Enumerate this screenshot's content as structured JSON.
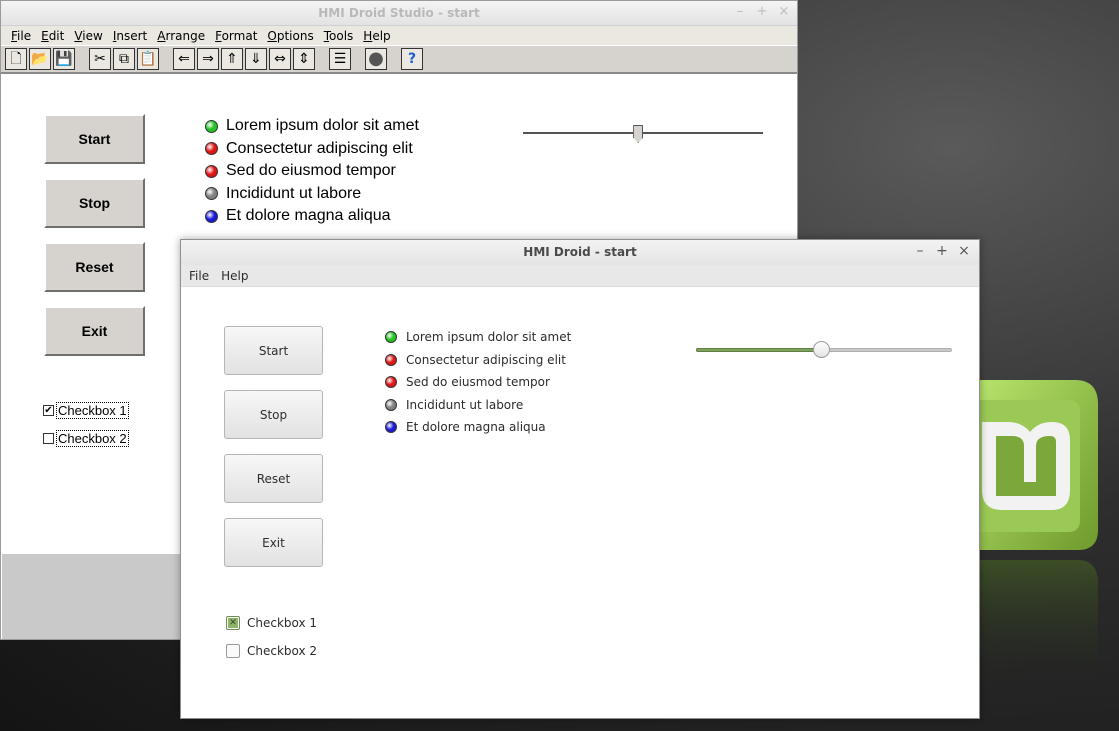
{
  "studio": {
    "title": "HMI Droid Studio - start",
    "window_controls": [
      "–",
      "+",
      "×"
    ],
    "menu": [
      "File",
      "Edit",
      "View",
      "Insert",
      "Arrange",
      "Format",
      "Options",
      "Tools",
      "Help"
    ],
    "toolbar": [
      {
        "icon": "new-file-icon",
        "glyph": "🗋"
      },
      {
        "icon": "open-folder-icon",
        "glyph": "📂"
      },
      {
        "icon": "save-icon",
        "glyph": "💾"
      },
      {
        "icon": "cut-icon",
        "glyph": "✂"
      },
      {
        "icon": "copy-icon",
        "glyph": "⧉"
      },
      {
        "icon": "paste-icon",
        "glyph": "📋"
      },
      {
        "icon": "arrow-left-icon",
        "glyph": "⇐"
      },
      {
        "icon": "arrow-right-icon",
        "glyph": "⇒"
      },
      {
        "icon": "arrow-up-icon",
        "glyph": "⇑"
      },
      {
        "icon": "arrow-down-icon",
        "glyph": "⇓"
      },
      {
        "icon": "arrow-horizontal-icon",
        "glyph": "⇔"
      },
      {
        "icon": "arrow-vertical-icon",
        "glyph": "⇕"
      },
      {
        "icon": "properties-icon",
        "glyph": "☰"
      },
      {
        "icon": "record-icon",
        "glyph": "●"
      },
      {
        "icon": "help-icon",
        "glyph": "?"
      }
    ],
    "buttons": [
      "Start",
      "Stop",
      "Reset",
      "Exit"
    ],
    "leds": [
      {
        "label": "Lorem ipsum dolor sit amet",
        "color": "#22c322"
      },
      {
        "label": "Consectetur adipiscing elit",
        "color": "#e01515"
      },
      {
        "label": "Sed do eiusmod tempor",
        "color": "#e01515"
      },
      {
        "label": "Incididunt ut labore",
        "color": "#808080"
      },
      {
        "label": "Et dolore magna aliqua",
        "color": "#1a1ad6"
      }
    ],
    "slider_value": 0.48,
    "checkboxes": [
      {
        "label": "Checkbox 1",
        "checked": true
      },
      {
        "label": "Checkbox 2",
        "checked": false
      }
    ]
  },
  "droid": {
    "title": "HMI Droid - start",
    "window_controls": [
      "–",
      "+",
      "×"
    ],
    "menu": [
      "File",
      "Help"
    ],
    "buttons": [
      "Start",
      "Stop",
      "Reset",
      "Exit"
    ],
    "leds": [
      {
        "label": "Lorem ipsum dolor sit amet",
        "color": "#22c322"
      },
      {
        "label": "Consectetur adipiscing elit",
        "color": "#e01515"
      },
      {
        "label": "Sed do eiusmod tempor",
        "color": "#e01515"
      },
      {
        "label": "Incididunt ut labore",
        "color": "#808080"
      },
      {
        "label": "Et dolore magna aliqua",
        "color": "#1a1ad6"
      }
    ],
    "slider_value": 0.49,
    "checkboxes": [
      {
        "label": "Checkbox 1",
        "checked": true
      },
      {
        "label": "Checkbox 2",
        "checked": false
      }
    ]
  },
  "colors": {
    "accent": "#8fb36a",
    "classic_face": "#d6d3ce"
  }
}
